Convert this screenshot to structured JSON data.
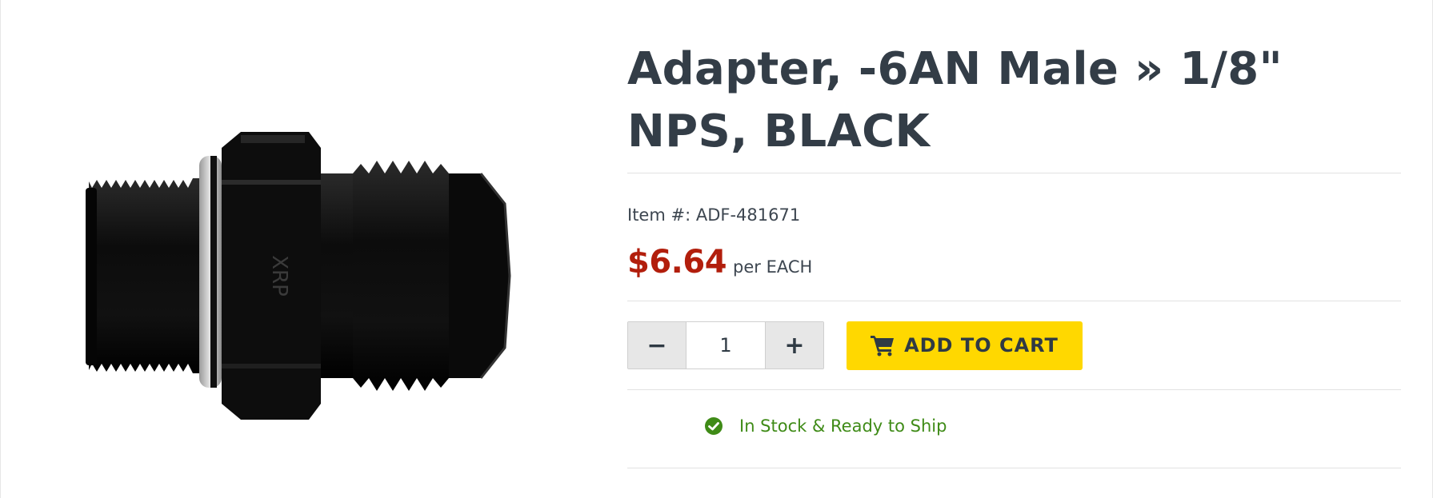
{
  "product": {
    "title": "Adapter, -6AN Male » 1/8\" NPS, BLACK",
    "item_number": "Item #: ADF-481671",
    "price": "$6.64",
    "per_unit": "per EACH",
    "image_icon": "black-an-adapter-fitting-photo"
  },
  "cart": {
    "decrement_label": "−",
    "quantity": "1",
    "increment_label": "+",
    "add_to_cart_label": "ADD TO CART",
    "cart_icon": "shopping-cart-icon",
    "button_color": "#ffd800"
  },
  "stock": {
    "status_text": "In Stock & Ready to Ship",
    "status_icon": "check-circle-icon",
    "status_color": "#3f8b17"
  },
  "colors": {
    "title": "#333d47",
    "price": "#b21e0c"
  }
}
